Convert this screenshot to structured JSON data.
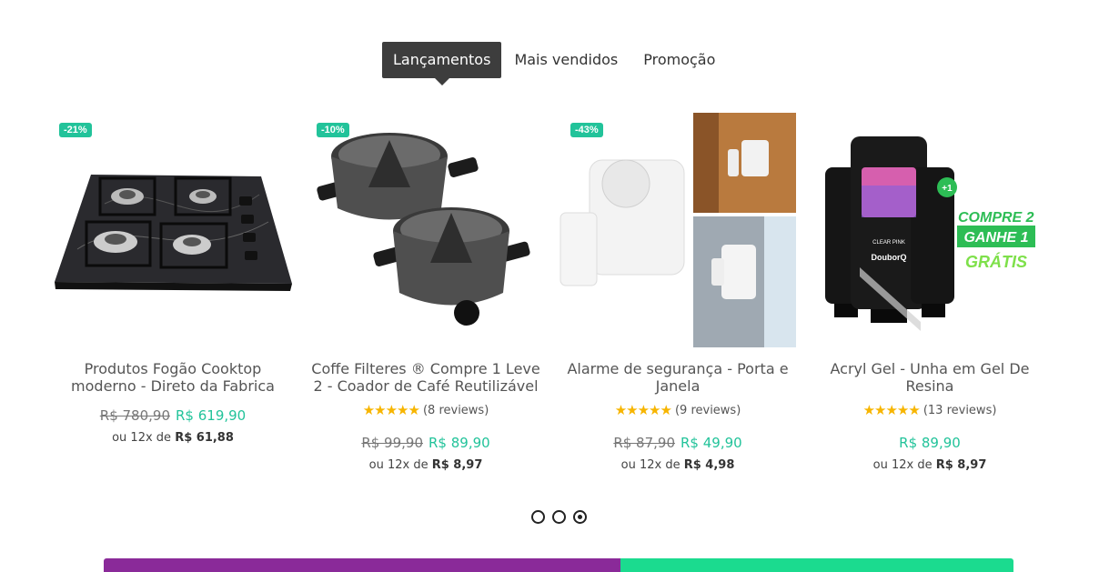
{
  "tabs": [
    {
      "label": "Lançamentos",
      "active": true
    },
    {
      "label": "Mais vendidos",
      "active": false
    },
    {
      "label": "Promoção",
      "active": false
    }
  ],
  "products": [
    {
      "badge": "-21%",
      "title": "Produtos Fogão Cooktop moderno - Direto da Fabrica",
      "old_price": "R$ 780,90",
      "price": "R$ 619,90",
      "installment_prefix": "ou 12x de",
      "installment_value": "R$ 61,88"
    },
    {
      "badge": "-10%",
      "title": "Coffe Filteres ® Compre 1 Leve 2 - Coador de Café Reutilizável",
      "stars": "★★★★★",
      "reviews": "(8 reviews)",
      "old_price": "R$ 99,90",
      "price": "R$ 89,90",
      "installment_prefix": "ou 12x de",
      "installment_value": "R$ 8,97"
    },
    {
      "badge": "-43%",
      "title": "Alarme de segurança - Porta e Janela",
      "stars": "★★★★★",
      "reviews": "(9 reviews)",
      "old_price": "R$ 87,90",
      "price": "R$ 49,90",
      "installment_prefix": "ou 12x de",
      "installment_value": "R$ 4,98"
    },
    {
      "title": "Acryl Gel - Unha em Gel De Resina",
      "stars": "★★★★★",
      "reviews": "(13 reviews)",
      "price": "R$ 89,90",
      "installment_prefix": "ou 12x de",
      "installment_value": "R$ 8,97",
      "promo_lines": [
        "COMPRE 2",
        "GANHE 1",
        "GRÁTIS"
      ],
      "promo_badge": "+1",
      "tube_labels": [
        "CLEAR PINK",
        "DouborQ"
      ]
    }
  ],
  "pagination": {
    "count": 3,
    "active": 3
  },
  "colors": {
    "accent": "#22c39a",
    "stars": "#f7b500",
    "tab_active_bg": "#3d3d3d",
    "banner_left": "#8a2a99",
    "banner_right": "#1bdb8f"
  }
}
